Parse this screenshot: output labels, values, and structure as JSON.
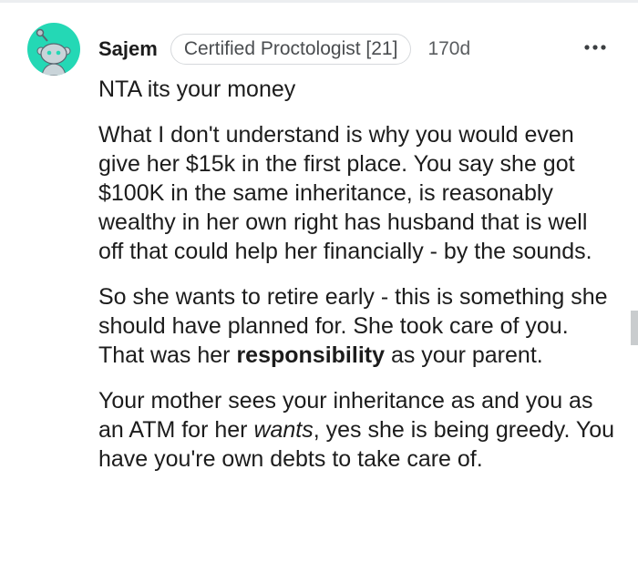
{
  "comment": {
    "username": "Sajem",
    "flair": "Certified Proctologist [21]",
    "timestamp": "170d",
    "more_icon": "more-horizontal-icon",
    "avatar_color": "#24d8b5",
    "paragraphs": {
      "p1": "NTA its your money",
      "p2": "What I don't understand is why you would even give her $15k in the first place. You say she got $100K in the same inheritance, is reasonably wealthy in her own right has husband that is well off that could help her financially - by the sounds.",
      "p3": {
        "before": "So she wants to retire early - this is something she should have planned for. She took care of you. That was her ",
        "bold": "responsibility",
        "after": " as your parent."
      },
      "p4": {
        "before": "Your mother sees your inheritance as and you as an ATM for her ",
        "italic": "wants",
        "after": ", yes she is being greedy. You have you're own debts to take care of."
      }
    }
  }
}
